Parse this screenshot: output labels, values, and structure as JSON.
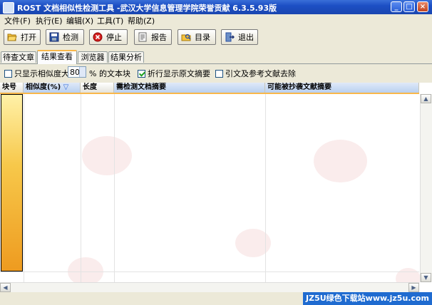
{
  "window": {
    "title": "ROST 文档相似性检测工具 -武汉大学信息管理学院荣誉贡献 6.3.5.93版",
    "min": "_",
    "max": "□",
    "close": "×"
  },
  "menu": [
    {
      "label": "文件(F)"
    },
    {
      "label": "执行(E)"
    },
    {
      "label": "编辑(X)"
    },
    {
      "label": "工具(T)"
    },
    {
      "label": "帮助(Z)"
    }
  ],
  "toolbar": {
    "open": "打开",
    "detect": "检测",
    "stop": "停止",
    "report": "报告",
    "catalog": "目录",
    "exit": "退出"
  },
  "tabs": [
    {
      "label": "待查文章"
    },
    {
      "label": "结果查看"
    },
    {
      "label": "浏览器"
    },
    {
      "label": "结果分析"
    }
  ],
  "options": {
    "only_show_prefix": "只显示相似度大",
    "threshold": "80",
    "only_show_suffix": "% 的文本块",
    "wrap_label": "折行显示原文摘要",
    "remove_refs_label": "引文及参考文献去除",
    "only_show_checked": false,
    "wrap_checked": true,
    "remove_refs_checked": false
  },
  "grid": {
    "columns": [
      "块号",
      "相似度(%)",
      "长度",
      "需检测文档摘要",
      "可能被抄袭文献摘要"
    ],
    "sort_indicator": "▽"
  },
  "watermark": "JZ5U绿色下载站www.jz5u.com"
}
